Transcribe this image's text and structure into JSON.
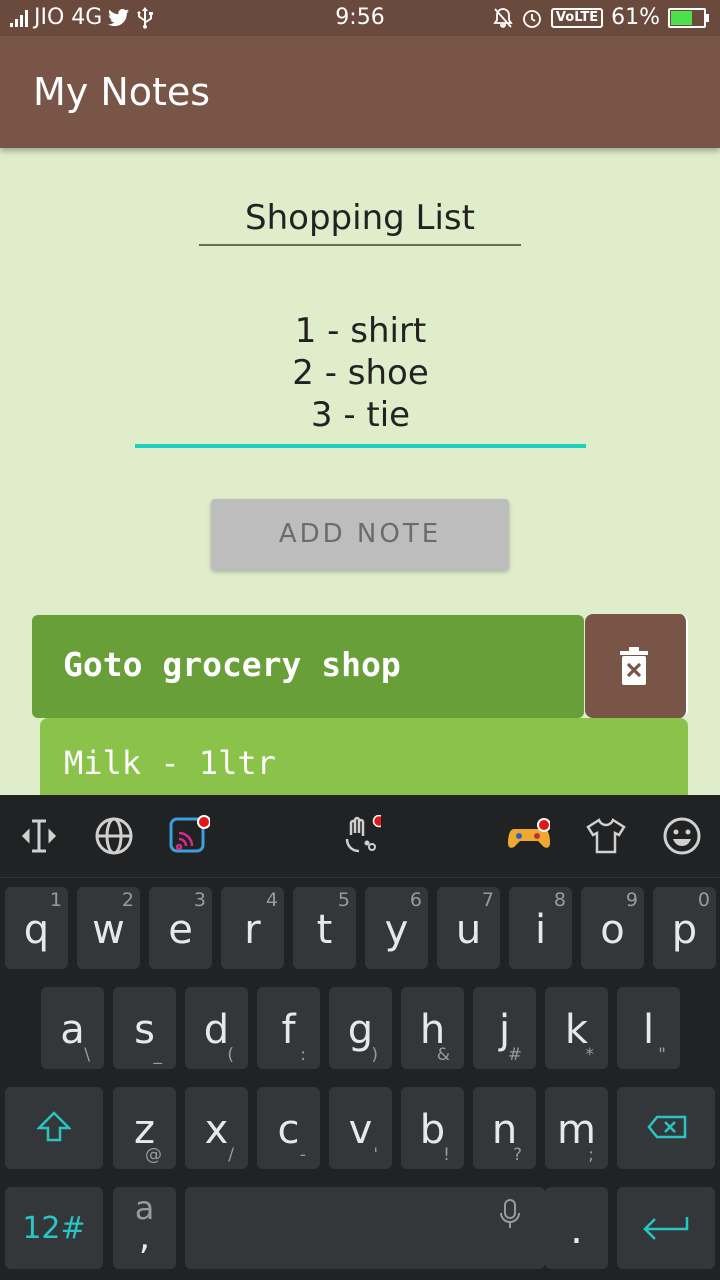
{
  "status_bar": {
    "carrier": "JIO 4G",
    "time": "9:56",
    "volte": "VoLTE",
    "battery": "61%",
    "battery_level": 0.61
  },
  "app_bar": {
    "title": "My Notes"
  },
  "form": {
    "title_value": "Shopping List",
    "body_lines": [
      "1 - shirt",
      "2 - shoe",
      "3 - tie"
    ],
    "add_button_label": "ADD NOTE"
  },
  "notes": [
    {
      "title": "Goto grocery shop",
      "body": "Milk - 1ltr"
    }
  ],
  "keyboard": {
    "row1": [
      {
        "main": "q",
        "sub": "1"
      },
      {
        "main": "w",
        "sub": "2"
      },
      {
        "main": "e",
        "sub": "3"
      },
      {
        "main": "r",
        "sub": "4"
      },
      {
        "main": "t",
        "sub": "5"
      },
      {
        "main": "y",
        "sub": "6"
      },
      {
        "main": "u",
        "sub": "7"
      },
      {
        "main": "i",
        "sub": "8"
      },
      {
        "main": "o",
        "sub": "9"
      },
      {
        "main": "p",
        "sub": "0"
      }
    ],
    "row2": [
      {
        "main": "a",
        "sub": "\\"
      },
      {
        "main": "s",
        "sub": "_"
      },
      {
        "main": "d",
        "sub": "("
      },
      {
        "main": "f",
        "sub": ":"
      },
      {
        "main": "g",
        "sub": ")"
      },
      {
        "main": "h",
        "sub": "&"
      },
      {
        "main": "j",
        "sub": "#"
      },
      {
        "main": "k",
        "sub": "*"
      },
      {
        "main": "l",
        "sub": "\""
      }
    ],
    "row3": [
      {
        "main": "z",
        "sub": "@"
      },
      {
        "main": "x",
        "sub": "/"
      },
      {
        "main": "c",
        "sub": "-"
      },
      {
        "main": "v",
        "sub": "'"
      },
      {
        "main": "b",
        "sub": "!"
      },
      {
        "main": "n",
        "sub": "?"
      },
      {
        "main": "m",
        "sub": ";"
      }
    ],
    "symbols_key": "12#",
    "comma_key_top": "a",
    "comma_key_bottom": ",",
    "period_key": ".",
    "accent_color": "#29c4c4"
  }
}
